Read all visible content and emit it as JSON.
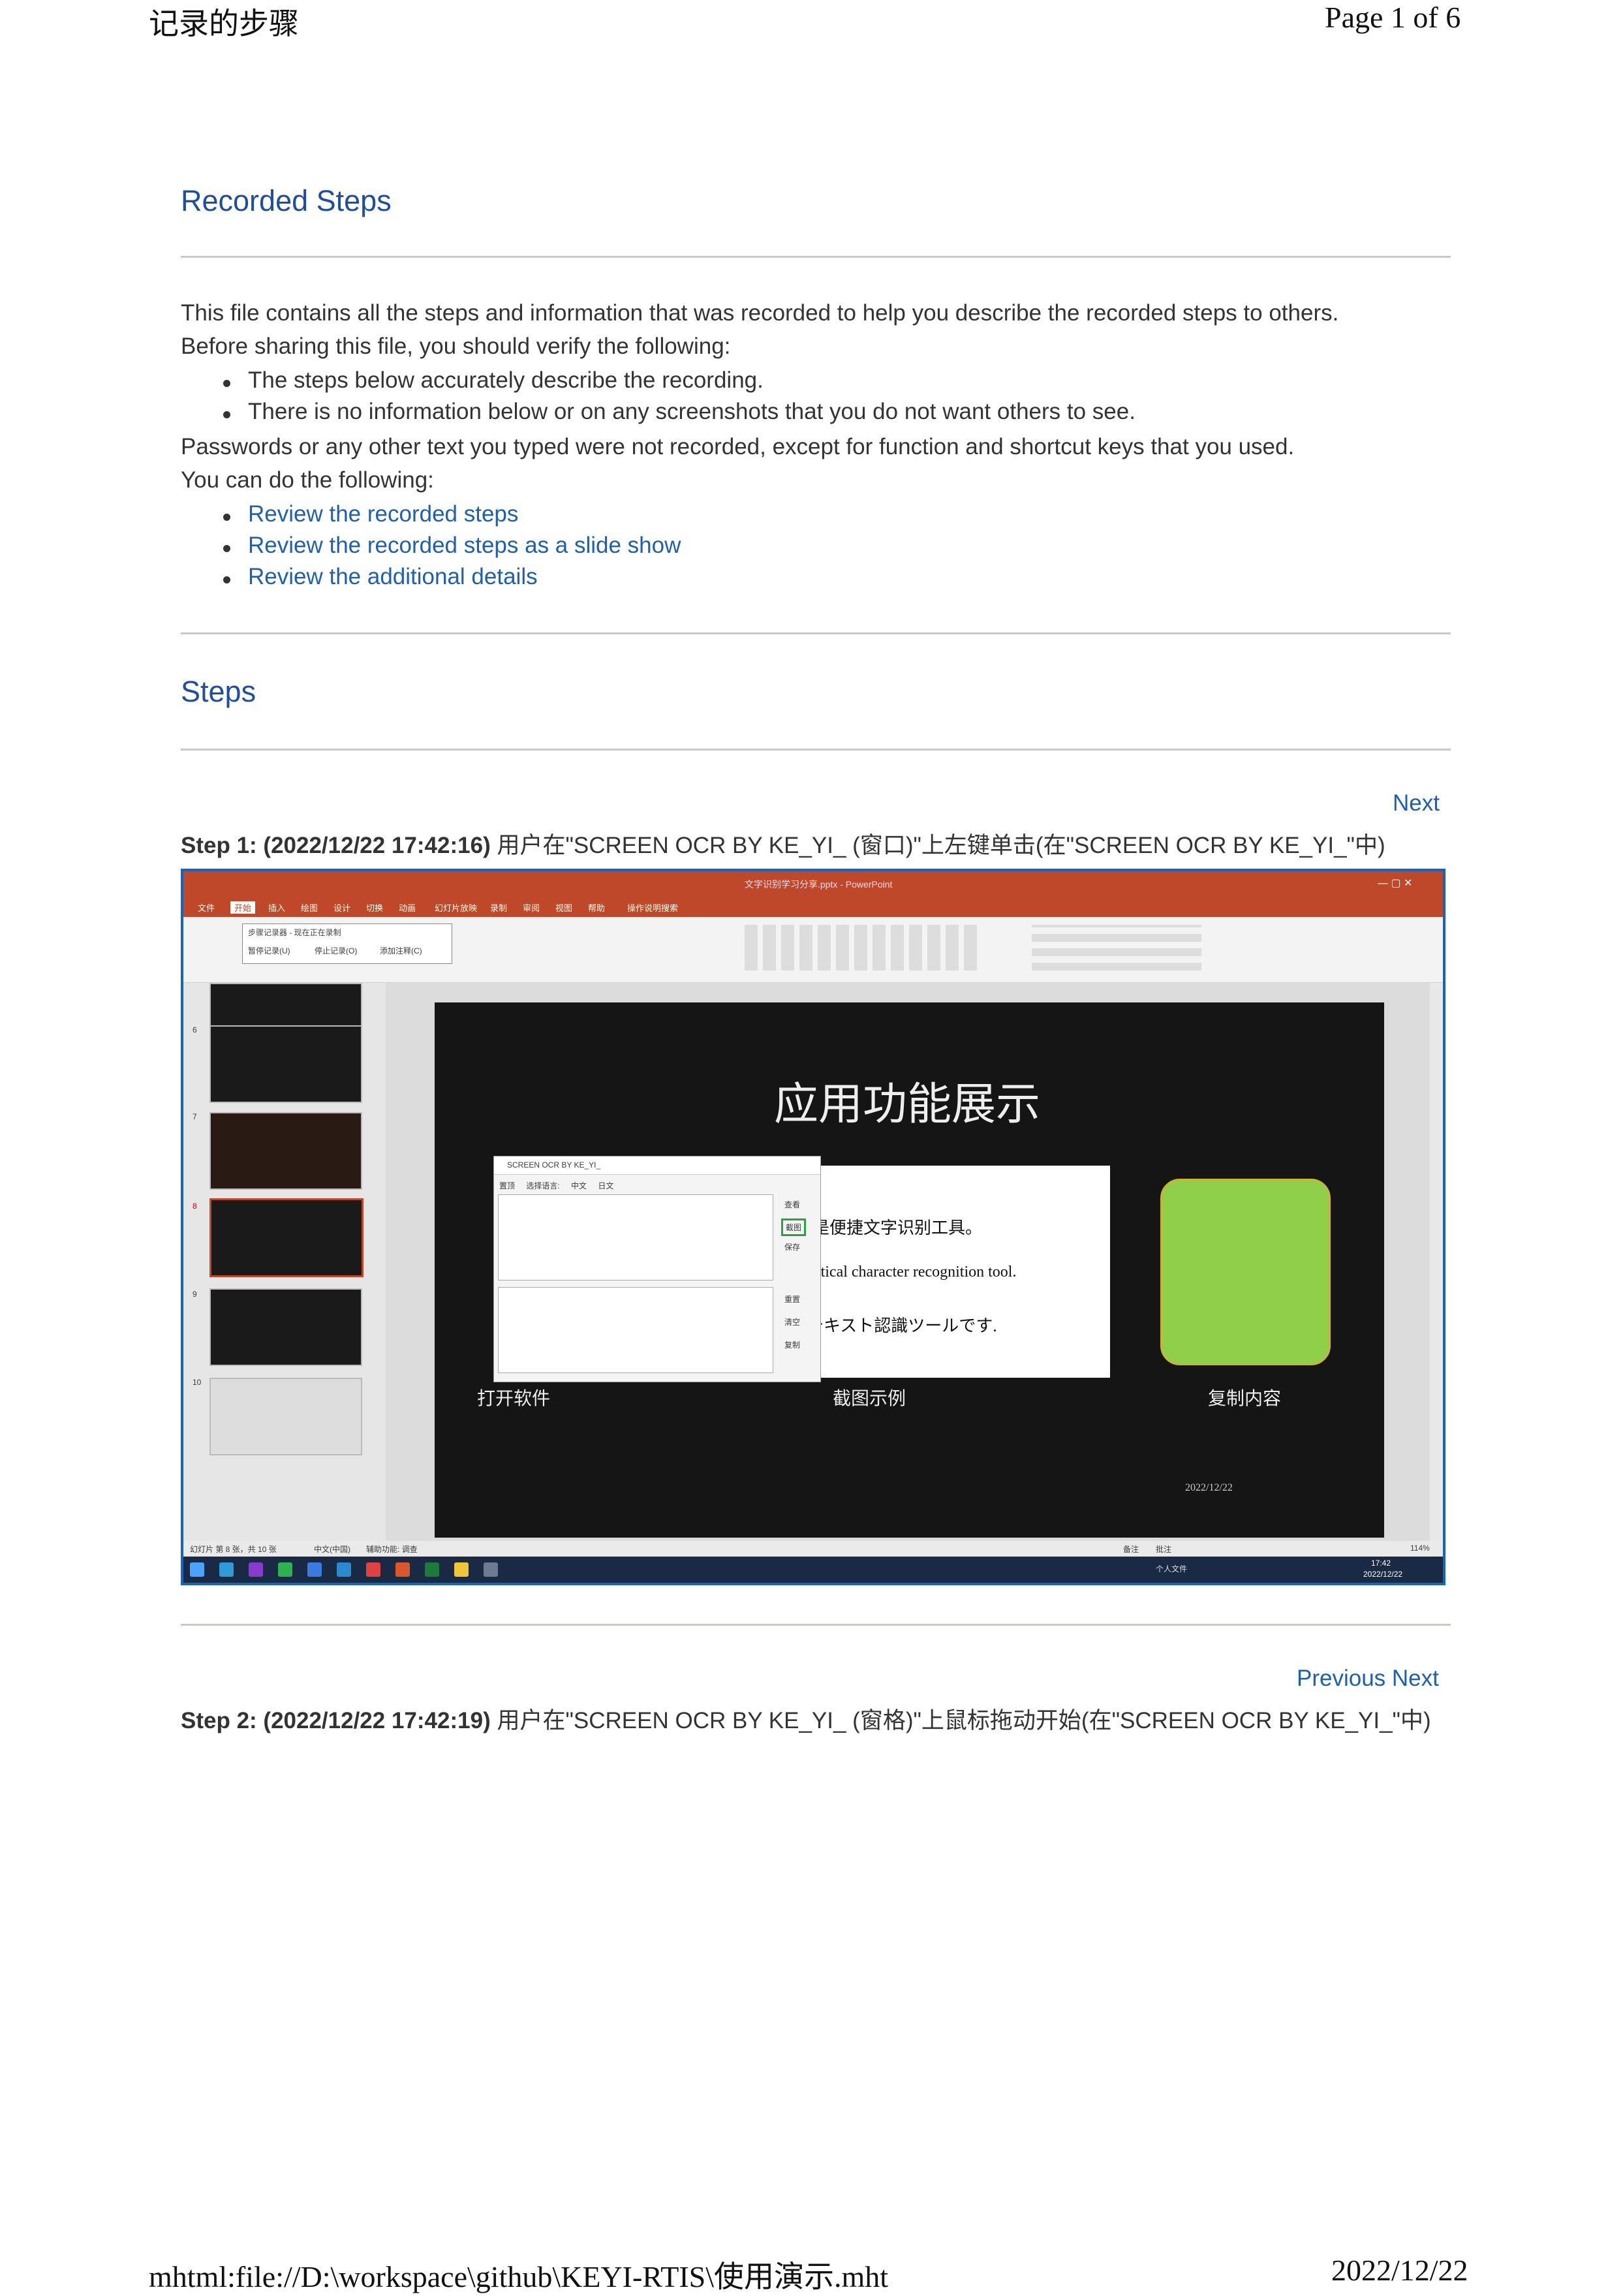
{
  "print_header": {
    "title": "记录的步骤",
    "page": "Page 1 of 6"
  },
  "print_footer": {
    "url": "mhtml:file://D:\\workspace\\github\\KEYI-RTIS\\使用演示.mht",
    "date": "2022/12/22"
  },
  "heading": "Recorded Steps",
  "intro": {
    "line1": "This file contains all the steps and information that was recorded to help you describe the recorded steps to others.",
    "line2": "Before sharing this file, you should verify the following:",
    "bullets": [
      "The steps below accurately describe the recording.",
      "There is no information below or on any screenshots that you do not want others to see."
    ],
    "line3": "Passwords or any other text you typed were not recorded, except for function and shortcut keys that you used.",
    "line4": "You can do the following:",
    "links": [
      "Review the recorded steps",
      "Review the recorded steps as a slide show",
      "Review the additional details"
    ]
  },
  "steps_heading": "Steps",
  "step1": {
    "nav_next": "Next",
    "label": "Step 1: (2022/12/22 17:42:16)",
    "desc": "用户在\"SCREEN OCR BY KE_YI_ (窗口)\"上左键单击(在\"SCREEN OCR BY KE_YI_\"中)"
  },
  "step2": {
    "nav_prev": "Previous",
    "nav_next": "Next",
    "label": "Step 2: (2022/12/22 17:42:19)",
    "desc": "用户在\"SCREEN OCR BY KE_YI_ (窗格)\"上鼠标拖动开始(在\"SCREEN OCR BY KE_YI_\"中)"
  },
  "screenshot": {
    "window_title": "文字识别学习分享.pptx - PowerPoint",
    "tabs": [
      "文件",
      "开始",
      "插入",
      "绘图",
      "设计",
      "切换",
      "动画",
      "幻灯片放映",
      "录制",
      "审阅",
      "视图",
      "帮助",
      "操作说明搜索"
    ],
    "slide_title": "应用功能展示",
    "box_lines": [
      "你好，我是便捷文字识别工具。",
      "Hello I'm convenient optical character recognition tool.",
      "私は便利なテキスト認識ツールです."
    ],
    "captions": [
      "打开软件",
      "截图示例",
      "复制内容"
    ],
    "slide_date": "2022/12/22",
    "ocr_window_title": "SCREEN OCR BY KE_YI_",
    "ocr_buttons": [
      "查看",
      "截图",
      "保存",
      "重置",
      "清空",
      "复制"
    ],
    "ocr_options": [
      "置顶",
      "选择语言:",
      "中文",
      "日文"
    ],
    "recorder_title": "步骤记录器 - 现在正在录制",
    "recorder_buttons": [
      "暂停记录(U)",
      "停止记录(O)",
      "添加注释(C)"
    ],
    "thumb_numbers": [
      "6",
      "7",
      "8",
      "9",
      "10"
    ],
    "status_left": "幻灯片 第 8 张，共 10 张",
    "status_lang": "中文(中国)",
    "status_access": "辅助功能: 调查",
    "status_notes": "备注",
    "status_comments": "批注",
    "zoom": "114%",
    "clock_time": "17:42",
    "clock_date": "2022/12/22",
    "tray_text": "个人文件"
  }
}
